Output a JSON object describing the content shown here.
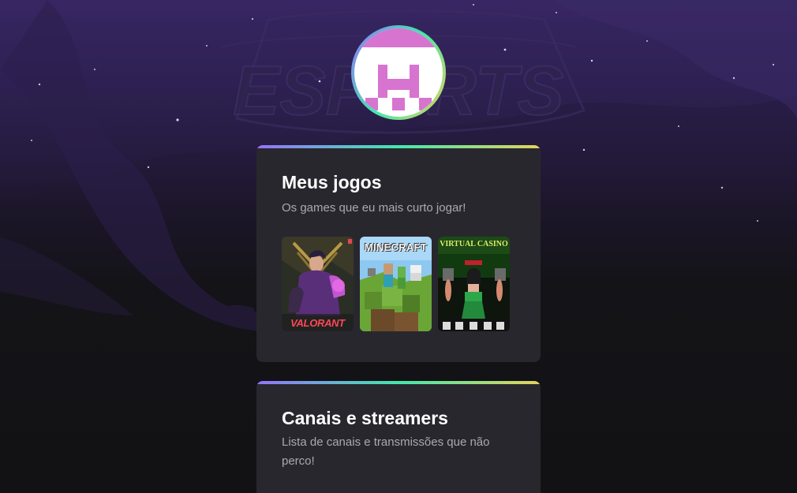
{
  "profile": {
    "avatar_icon": "pixel-invader-icon",
    "background_text": "ESPORTS"
  },
  "games_section": {
    "title": "Meus jogos",
    "description": "Os games que eu mais curto jogar!",
    "games": [
      {
        "name": "VALORANT",
        "icon": "valorant-cover"
      },
      {
        "name": "MINECRAFT",
        "icon": "minecraft-cover"
      },
      {
        "name": "VIRTUAL CASINO",
        "icon": "virtual-casino-cover"
      }
    ]
  },
  "channels_section": {
    "title": "Canais e streamers",
    "description": "Lista de canais e transmissões que não perco!"
  },
  "colors": {
    "accent_gradient": [
      "#9572fc",
      "#43e7ad",
      "#e2d45c"
    ],
    "card_bg": "#29272e",
    "page_bg": "#121214",
    "avatar_pixel": "#d774cf"
  }
}
